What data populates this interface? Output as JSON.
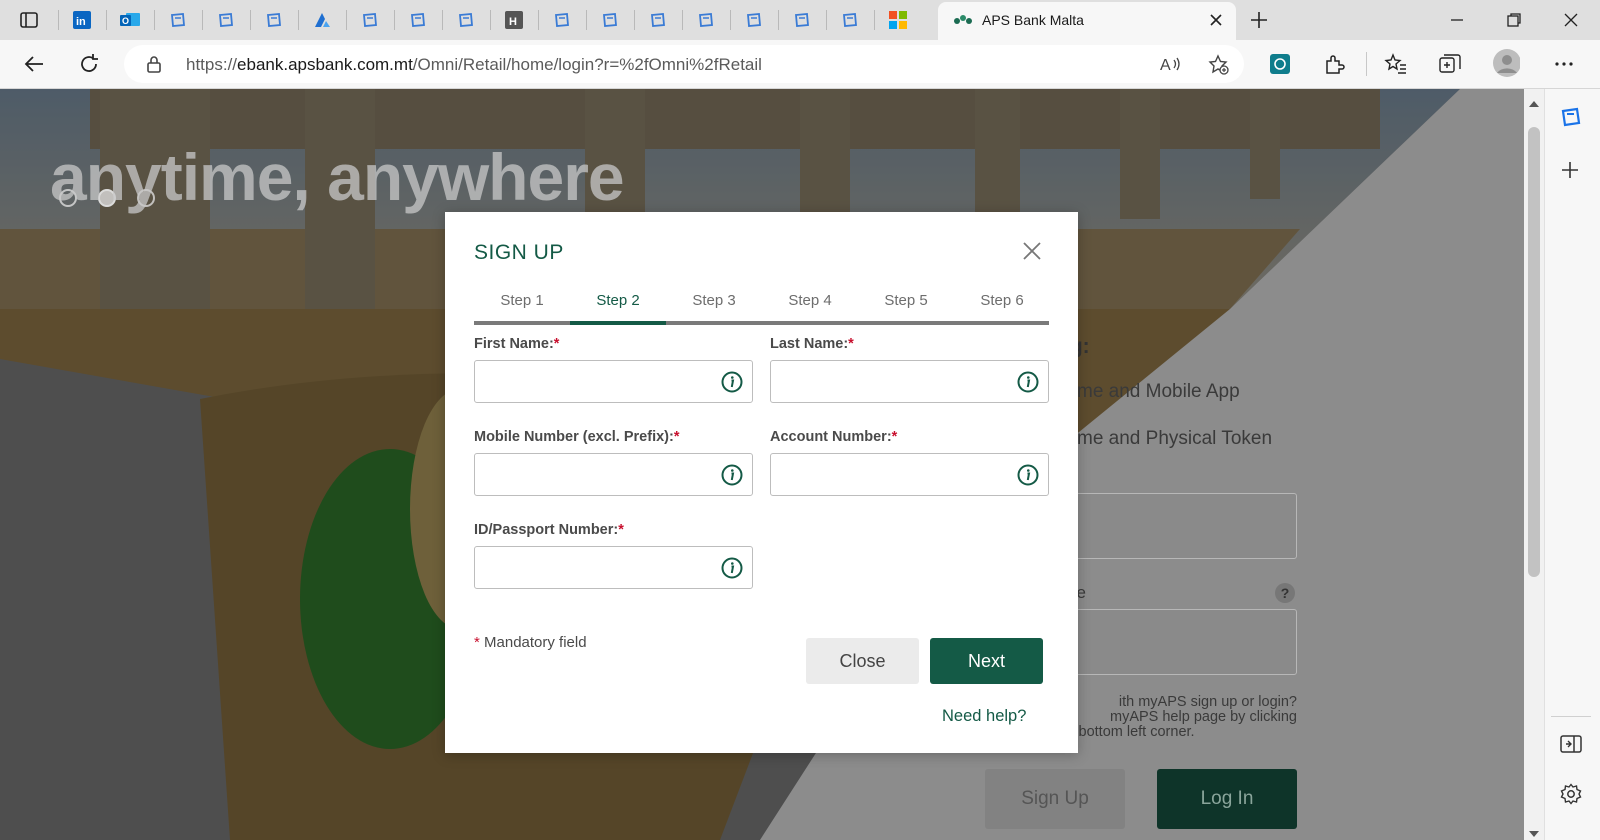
{
  "browser": {
    "active_tab_title": "APS Bank Malta",
    "url_prefix": "https://",
    "url_host": "ebank.apsbank.com.mt",
    "url_path": "/Omni/Retail/home/login?r=%2fOmni%2fRetail",
    "pinned_tab_icons": [
      "sidebar-tabs-icon",
      "linkedin-icon",
      "outlook-icon",
      "edge-page-icon",
      "edge-page-icon",
      "edge-page-icon",
      "azure-icon",
      "edge-page-icon",
      "edge-page-icon",
      "edge-page-icon",
      "app-h-icon",
      "edge-page-icon",
      "edge-page-icon",
      "edge-page-icon",
      "edge-page-icon",
      "edge-page-icon",
      "edge-page-icon",
      "edge-page-icon",
      "microsoft-icon"
    ]
  },
  "background": {
    "hero_text": "anytime, anywhere",
    "panel_heading_fragment": "ng:",
    "option_1_fragment": "me and Mobile App",
    "option_2_fragment": "me and Physical Token",
    "code_label_fragment": "de",
    "code_help": "?",
    "help_line_1": "ith myAPS sign up or login?",
    "help_line_2": "myAPS help page by clicking",
    "help_line_3": "on Help in the bottom left corner.",
    "sign_up_label": "Sign Up",
    "log_in_label": "Log In"
  },
  "modal": {
    "title": "SIGN UP",
    "steps": [
      "Step 1",
      "Step 2",
      "Step 3",
      "Step 4",
      "Step 5",
      "Step 6"
    ],
    "active_step": 2,
    "fields": {
      "first_name": {
        "label": "First Name:",
        "required_mark": "*",
        "value": ""
      },
      "last_name": {
        "label": "Last Name:",
        "required_mark": "*",
        "value": ""
      },
      "mobile": {
        "label": "Mobile Number (excl. Prefix):",
        "required_mark": "*",
        "value": ""
      },
      "account": {
        "label": "Account Number:",
        "required_mark": "*",
        "value": ""
      },
      "id_passport": {
        "label": "ID/Passport Number:",
        "required_mark": "*",
        "value": ""
      }
    },
    "mandatory_mark": "*",
    "mandatory_text": "Mandatory field",
    "close_label": "Close",
    "next_label": "Next",
    "need_help_label": "Need help?"
  },
  "colors": {
    "brand_green": "#145a46",
    "required_red": "#c8102e"
  }
}
